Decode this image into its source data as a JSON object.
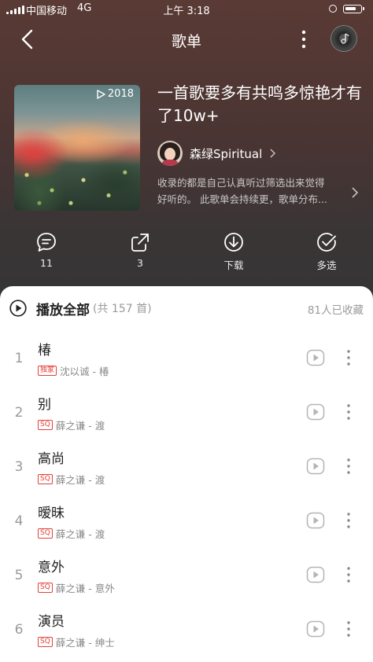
{
  "status_bar": {
    "carrier": "中国移动",
    "network": "4G",
    "time": "上午 3:18"
  },
  "nav": {
    "title": "歌单",
    "icons": {
      "back": "chevron-left-icon",
      "more": "more-vertical-icon",
      "now_playing": "vinyl-disc-icon"
    }
  },
  "playlist": {
    "play_count": "2018",
    "title": "一首歌要多有共鸣多惊艳才有了10w+",
    "creator": "森绿Spiritual",
    "description_lines": [
      "收录的都是自己认真听过筛选出来觉得",
      "好听的。 此歌单会持续更，歌单分布..."
    ]
  },
  "actions": [
    {
      "icon": "comment-icon",
      "label": "11"
    },
    {
      "icon": "share-icon",
      "label": "3"
    },
    {
      "icon": "download-icon",
      "label": "下载"
    },
    {
      "icon": "multi-select-icon",
      "label": "多选"
    }
  ],
  "list_header": {
    "play_all_label": "播放全部",
    "count_label": "(共 157 首)",
    "collectors": "81人已收藏"
  },
  "tracks": [
    {
      "no": "1",
      "title": "椿",
      "badge": "独家",
      "meta": "沈以诚 - 椿"
    },
    {
      "no": "2",
      "title": "别",
      "badge": "SQ",
      "meta": "薛之谦 - 渡"
    },
    {
      "no": "3",
      "title": "高尚",
      "badge": "SQ",
      "meta": "薛之谦 - 渡"
    },
    {
      "no": "4",
      "title": "暧昧",
      "badge": "SQ",
      "meta": "薛之谦 - 渡"
    },
    {
      "no": "5",
      "title": "意外",
      "badge": "SQ",
      "meta": "薛之谦 - 意外"
    },
    {
      "no": "6",
      "title": "演员",
      "badge": "SQ",
      "meta": "薛之谦 - 绅士"
    }
  ],
  "colors": {
    "header_bg": "#4a3533",
    "accent_red": "#e2403a",
    "list_bg": "#ffffff"
  }
}
